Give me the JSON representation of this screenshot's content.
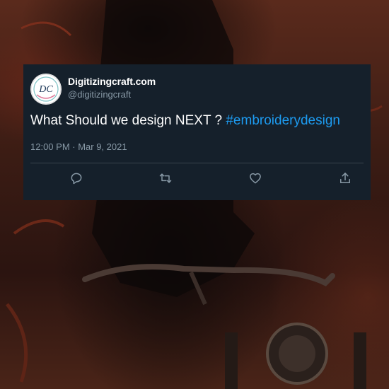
{
  "tweet": {
    "display_name": "Digitizingcraft.com",
    "handle": "@digitizingcraft",
    "text": "What Should we design NEXT ? ",
    "hashtag": "#embroiderydesign",
    "timestamp": "12:00 PM · Mar 9, 2021",
    "avatar": {
      "initials": "DC"
    }
  },
  "actions": [
    {
      "icon": "reply-icon"
    },
    {
      "icon": "retweet-icon"
    },
    {
      "icon": "like-icon"
    },
    {
      "icon": "share-icon"
    }
  ],
  "colors": {
    "card_background": "#15202b",
    "accent": "#1d9bf0",
    "secondary_text": "#8899a6"
  }
}
